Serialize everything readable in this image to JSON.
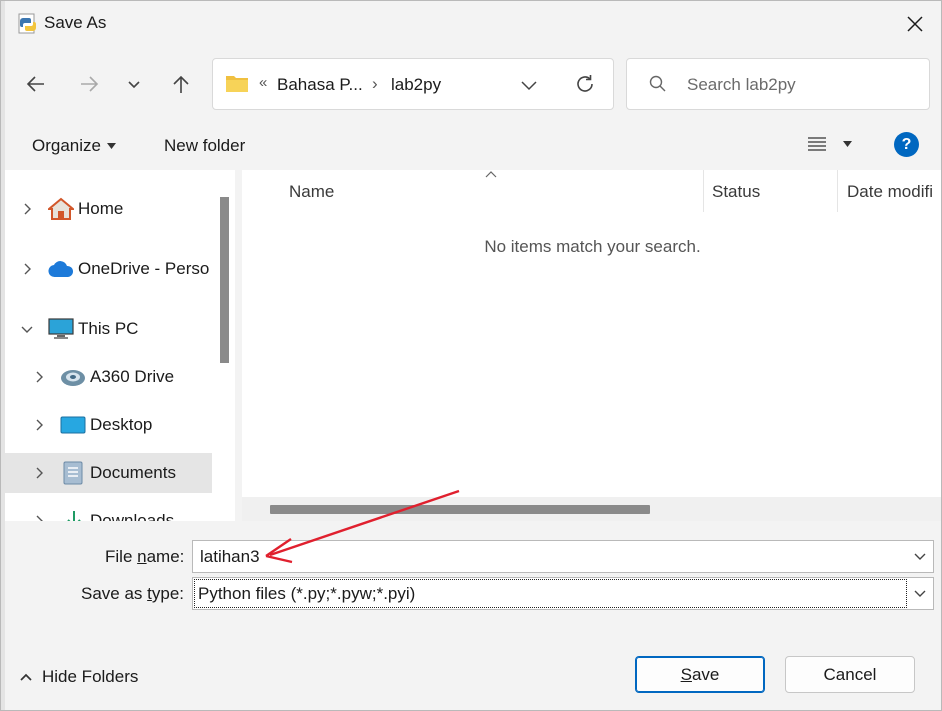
{
  "window": {
    "title": "Save As"
  },
  "address_bar": {
    "crumb_overflow": "«",
    "crumbs": [
      "Bahasa P...",
      "lab2py"
    ],
    "separator": "›"
  },
  "search": {
    "placeholder": "Search lab2py"
  },
  "toolbar": {
    "organize": "Organize",
    "new_folder": "New folder",
    "help": "?"
  },
  "nav_tree": {
    "items": [
      {
        "label": "Home",
        "icon": "home-icon",
        "expanded": false
      },
      {
        "label": "OneDrive - Perso",
        "icon": "onedrive-cloud-icon",
        "expanded": false
      },
      {
        "label": "This PC",
        "icon": "monitor-icon",
        "expanded": true
      },
      {
        "label": "A360 Drive",
        "icon": "a360-drive-icon",
        "expanded": false
      },
      {
        "label": "Desktop",
        "icon": "desktop-icon",
        "expanded": false
      },
      {
        "label": "Documents",
        "icon": "documents-icon",
        "expanded": false,
        "selected": true
      },
      {
        "label": "Downloads",
        "icon": "downloads-icon",
        "expanded": false
      }
    ]
  },
  "file_list": {
    "columns": [
      "Name",
      "Status",
      "Date modifi"
    ],
    "empty_message": "No items match your search."
  },
  "form": {
    "file_name_label_pre": "File ",
    "file_name_label_key": "n",
    "file_name_label_post": "ame:",
    "file_name_value": "latihan3",
    "save_type_label_pre": "Save as ",
    "save_type_label_key": "t",
    "save_type_label_post": "ype:",
    "save_type_value": "Python files (*.py;*.pyw;*.pyi)"
  },
  "footer": {
    "hide_folders": "Hide Folders",
    "save_key": "S",
    "save_rest": "ave",
    "cancel": "Cancel"
  },
  "colors": {
    "accent": "#0067c0",
    "annotation_arrow": "#e0202e"
  }
}
